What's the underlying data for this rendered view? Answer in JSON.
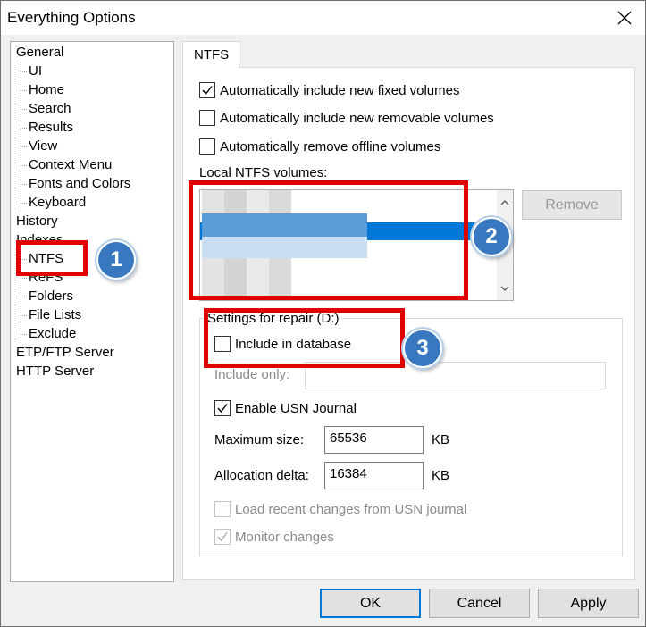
{
  "window": {
    "title": "Everything Options",
    "close_icon": "close-icon"
  },
  "tree": {
    "general": "General",
    "general_children": [
      "UI",
      "Home",
      "Search",
      "Results",
      "View",
      "Context Menu",
      "Fonts and Colors",
      "Keyboard"
    ],
    "history": "History",
    "indexes": "Indexes",
    "indexes_children": [
      "NTFS",
      "ReFS",
      "Folders",
      "File Lists",
      "Exclude"
    ],
    "etp": "ETP/FTP Server",
    "http": "HTTP Server"
  },
  "tab": {
    "label": "NTFS"
  },
  "options": {
    "auto_fixed": {
      "label": "Automatically include new fixed volumes",
      "checked": true
    },
    "auto_removable": {
      "label": "Automatically include new removable volumes",
      "checked": false
    },
    "auto_remove_offline": {
      "label": "Automatically remove offline volumes",
      "checked": false
    }
  },
  "volumes": {
    "label": "Local NTFS volumes:",
    "remove_label": "Remove"
  },
  "repair": {
    "group_label": "Settings for repair (D:)",
    "include_db": {
      "label": "Include in database",
      "checked": false
    },
    "include_only_label": "Include only:",
    "include_only_value": "",
    "usn": {
      "label": "Enable USN Journal",
      "checked": true
    },
    "max_size_label": "Maximum size:",
    "max_size_value": "65536",
    "max_size_unit": "KB",
    "alloc_label": "Allocation delta:",
    "alloc_value": "16384",
    "alloc_unit": "KB",
    "load_recent": {
      "label": "Load recent changes from USN journal",
      "checked": false
    },
    "monitor": {
      "label": "Monitor changes",
      "checked": true
    }
  },
  "buttons": {
    "ok": "OK",
    "cancel": "Cancel",
    "apply": "Apply"
  },
  "annotations": {
    "badge1": "1",
    "badge2": "2",
    "badge3": "3",
    "highlight_color": "#e00000",
    "badge_color": "#3878c0"
  }
}
